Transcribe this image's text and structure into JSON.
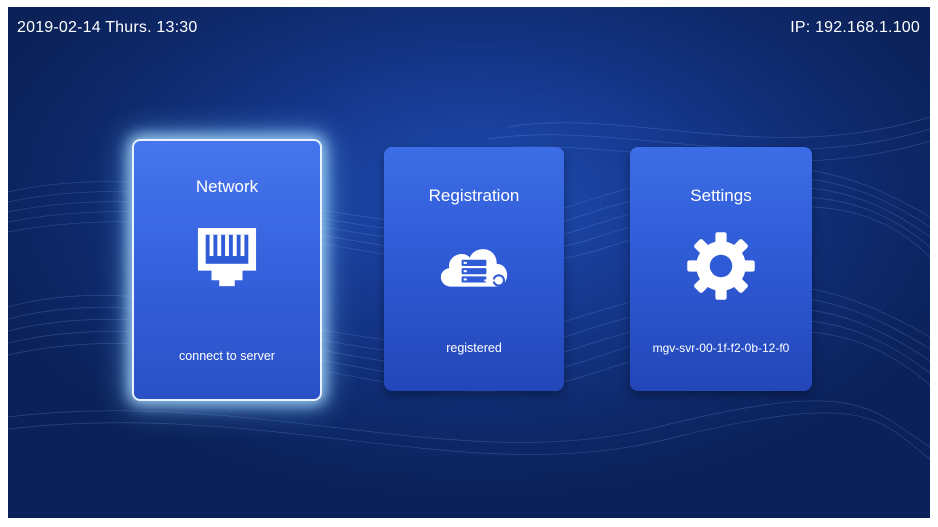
{
  "status_bar": {
    "datetime": "2019-02-14 Thurs. 13:30",
    "ip": "IP: 192.168.1.100"
  },
  "cards": [
    {
      "title": "Network",
      "subtitle": "connect to server",
      "icon": "ethernet-port-icon",
      "selected": true
    },
    {
      "title": "Registration",
      "subtitle": "registered",
      "icon": "cloud-server-key-icon",
      "selected": false
    },
    {
      "title": "Settings",
      "subtitle": "mgv-svr-00-1f-f2-0b-12-f0",
      "icon": "gear-icon",
      "selected": false
    }
  ],
  "colors": {
    "background": "#0f2b70",
    "card": "#2f5bd6",
    "selection_glow": "#aadcff",
    "text": "#ffffff"
  }
}
